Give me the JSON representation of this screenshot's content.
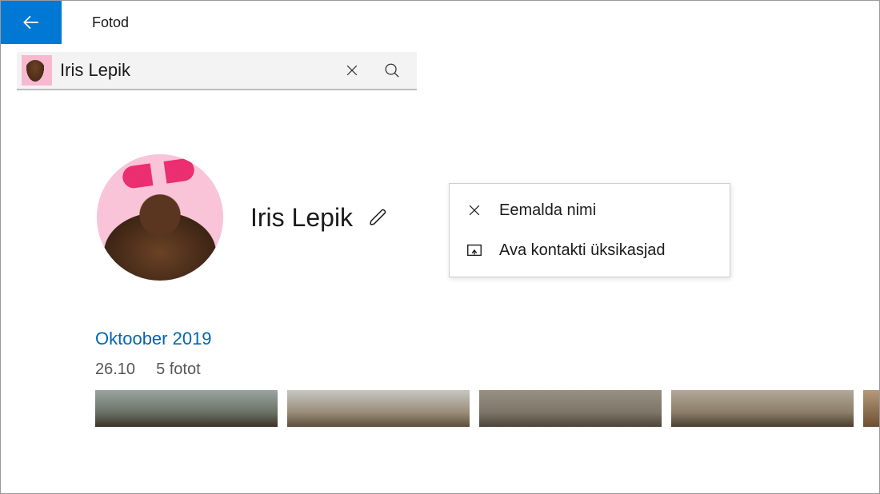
{
  "header": {
    "app_title": "Fotod"
  },
  "search": {
    "query": "Iris Lepik"
  },
  "profile": {
    "name": "Iris Lepik"
  },
  "context_menu": {
    "remove_name": "Eemalda nimi",
    "open_contact": "Ava kontakti üksikasjad"
  },
  "timeline": {
    "month_label": "Oktoober 2019",
    "day_label": "26.10",
    "count_label": "5 fotot"
  }
}
